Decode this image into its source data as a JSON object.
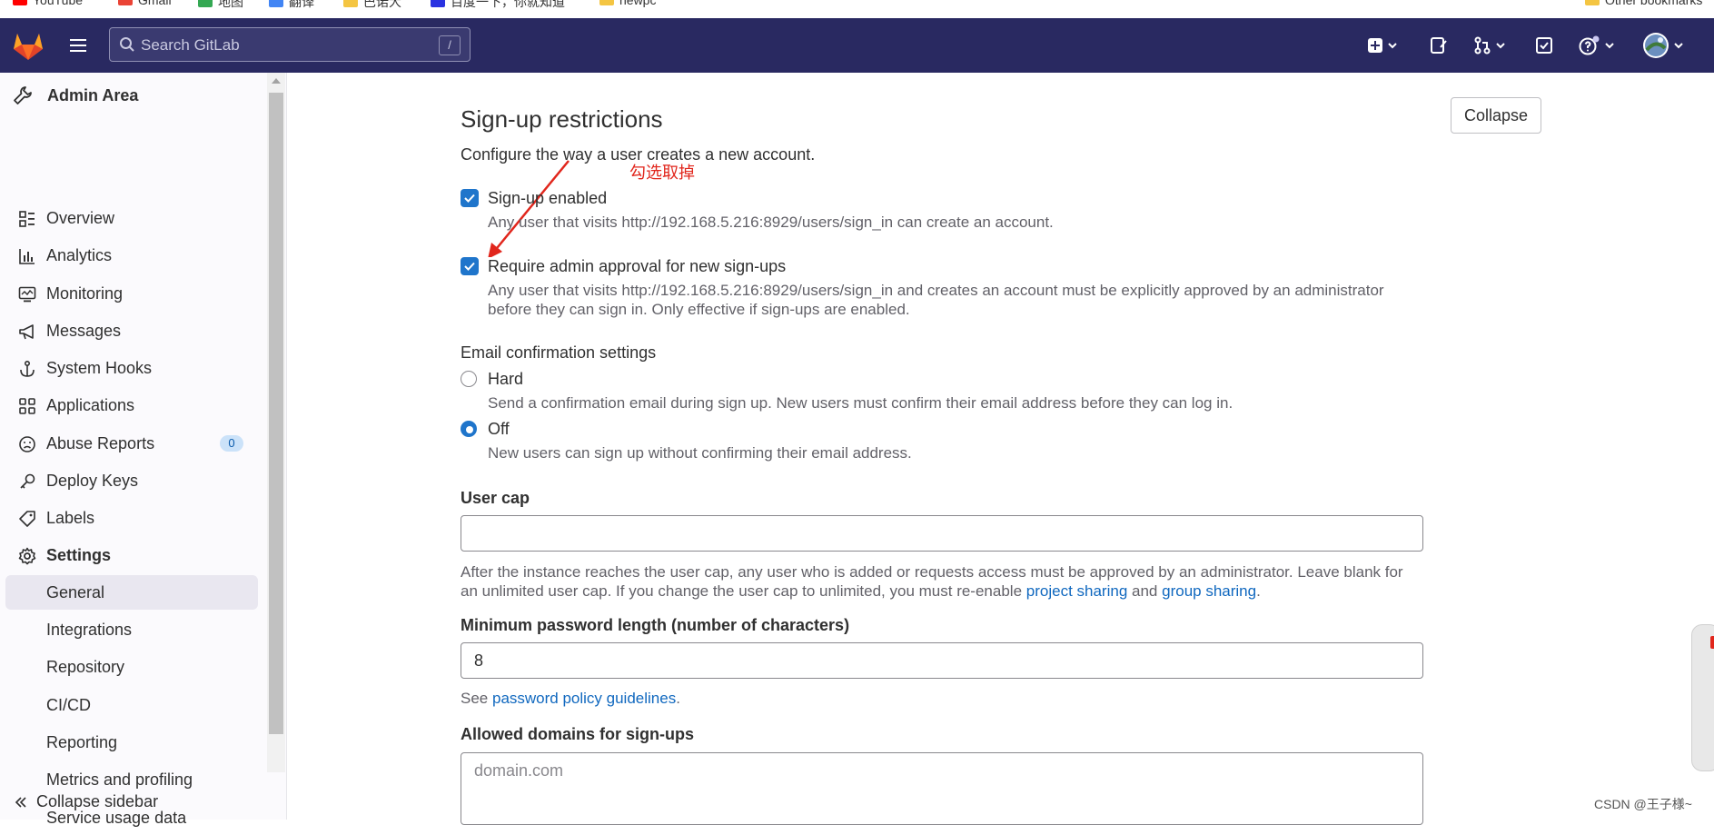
{
  "browser": {
    "bookmarks": [
      {
        "label": "YouTube",
        "color": "#ff0000"
      },
      {
        "label": "Gmail",
        "color": "#ea4335"
      },
      {
        "label": "地图",
        "color": "#34a853"
      },
      {
        "label": "翻译",
        "color": "#4285f4"
      },
      {
        "label": "巴诺大",
        "color": "#f4c542"
      },
      {
        "label": "百度一下，你就知道",
        "color": "#2932e1"
      },
      {
        "label": "newpc",
        "color": "#f4c542"
      }
    ],
    "other_bookmarks": "Other bookmarks"
  },
  "header": {
    "search_placeholder": "Search GitLab",
    "search_shortcut": "/",
    "bg_color": "#292961"
  },
  "sidebar": {
    "title": "Admin Area",
    "items": [
      {
        "label": "Overview",
        "icon": "overview-icon"
      },
      {
        "label": "Analytics",
        "icon": "analytics-icon"
      },
      {
        "label": "Monitoring",
        "icon": "monitor-icon"
      },
      {
        "label": "Messages",
        "icon": "megaphone-icon"
      },
      {
        "label": "System Hooks",
        "icon": "anchor-icon"
      },
      {
        "label": "Applications",
        "icon": "applications-icon"
      },
      {
        "label": "Abuse Reports",
        "icon": "abuse-icon",
        "badge": "0"
      },
      {
        "label": "Deploy Keys",
        "icon": "key-icon"
      },
      {
        "label": "Labels",
        "icon": "label-icon"
      },
      {
        "label": "Settings",
        "icon": "settings-icon"
      }
    ],
    "settings_sub": [
      "General",
      "Integrations",
      "Repository",
      "CI/CD",
      "Reporting",
      "Metrics and profiling",
      "Service usage data"
    ],
    "active": "General",
    "collapse_label": "Collapse sidebar"
  },
  "main": {
    "title": "Sign-up restrictions",
    "collapse_button": "Collapse",
    "intro": "Configure the way a user creates a new account.",
    "annotation": "勾选取掉",
    "signup_enabled": {
      "label": "Sign-up enabled",
      "help": "Any user that visits http://192.168.5.216:8929/users/sign_in can create an account.",
      "checked": true
    },
    "admin_approval": {
      "label": "Require admin approval for new sign-ups",
      "help1": "Any user that visits http://192.168.5.216:8929/users/sign_in and creates an account must be explicitly approved by an administrator",
      "help2": "before they can sign in. Only effective if sign-ups are enabled.",
      "checked": true
    },
    "email_confirmation": {
      "label": "Email confirmation settings",
      "hard_label": "Hard",
      "hard_help": "Send a confirmation email during sign up. New users must confirm their email address before they can log in.",
      "off_label": "Off",
      "off_help": "New users can sign up without confirming their email address.",
      "selected": "Off"
    },
    "user_cap": {
      "label": "User cap",
      "value": "",
      "help1": "After the instance reaches the user cap, any user who is added or requests access must be approved by an administrator. Leave blank for",
      "help2_pre": "an unlimited user cap. If you change the user cap to unlimited, you must re-enable",
      "link1": "project sharing",
      "and": "and",
      "link2": "group sharing",
      "period": "."
    },
    "min_password": {
      "label": "Minimum password length (number of characters)",
      "value": "8",
      "help_pre": "See",
      "help_link": "password policy guidelines",
      "help_post": "."
    },
    "allowed_domains": {
      "label": "Allowed domains for sign-ups",
      "placeholder": "domain.com"
    }
  },
  "watermark": "CSDN @王子様~"
}
